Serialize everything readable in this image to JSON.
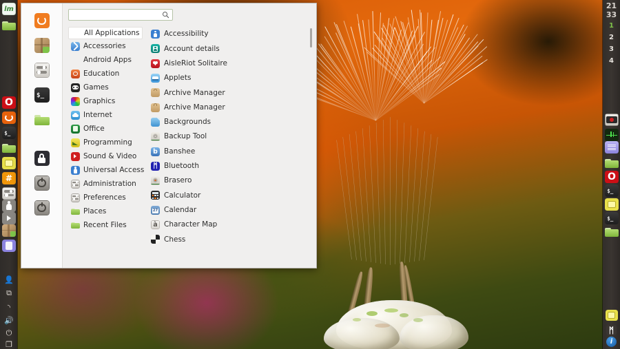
{
  "desktop": {
    "wallpaper_description": "dandelion seed head macro on orange and green bokeh background",
    "wallpaper_colors": {
      "orange": "#e4690c",
      "green": "#3e4a12",
      "magenta": "#8c1a6e"
    }
  },
  "left_panel": {
    "background": "#35312d",
    "launcher_items": [
      {
        "name": "linux-mint-menu-icon",
        "label": "Menu",
        "color": "#e8f3e8",
        "glyph": "lm"
      },
      {
        "name": "file-manager-icon",
        "label": "Files",
        "color": "#8bc34a",
        "glyph": "folder"
      },
      {
        "name": "opera-icon",
        "label": "Opera",
        "color": "#cc0f16",
        "glyph": "O"
      },
      {
        "name": "ubuntu-icon",
        "label": "Ubuntu",
        "color": "#e8620c",
        "glyph": "U"
      },
      {
        "name": "terminal-icon",
        "label": "Terminal",
        "color": "#2a2a2a",
        "glyph": "$_"
      },
      {
        "name": "folder-icon",
        "label": "Folder",
        "color": "#8bc34a",
        "glyph": "folder"
      },
      {
        "name": "notes-icon",
        "label": "Notes",
        "color": "#e8e04a",
        "glyph": "note"
      },
      {
        "name": "hash-icon",
        "label": "Hash",
        "color": "#f0960a",
        "glyph": "#"
      },
      {
        "name": "settings-toggle-icon",
        "label": "Settings",
        "color": "#d5d2cd",
        "glyph": "toggle"
      },
      {
        "name": "user-avatar-icon",
        "label": "User",
        "color": "#8a8782",
        "glyph": "person"
      },
      {
        "name": "media-player-icon",
        "label": "Player",
        "color": "#8a8782",
        "glyph": "play"
      },
      {
        "name": "package-icon",
        "label": "Package",
        "color": "#b08a5a",
        "glyph": "box"
      },
      {
        "name": "reader-icon",
        "label": "Reader",
        "color": "#8c84e0",
        "glyph": "book"
      }
    ],
    "tray_items": [
      {
        "name": "user-account-tray-icon",
        "label": "User account"
      },
      {
        "name": "screenshot-tray-icon",
        "label": "Screenshot"
      },
      {
        "name": "network-wifi-tray-icon",
        "label": "Network"
      },
      {
        "name": "volume-tray-icon",
        "label": "Volume"
      },
      {
        "name": "logout-tray-icon",
        "label": "Log out"
      },
      {
        "name": "displays-tray-icon",
        "label": "Displays"
      }
    ]
  },
  "right_panel": {
    "background": "#3a3531",
    "clock": {
      "hours": "21",
      "minutes": "33"
    },
    "workspaces": [
      {
        "label": "1",
        "active": true
      },
      {
        "label": "2",
        "active": false
      },
      {
        "label": "3",
        "active": false
      },
      {
        "label": "4",
        "active": false
      }
    ],
    "items": [
      {
        "name": "camera-icon",
        "label": "Camera",
        "color": "#d9d4ce",
        "glyph": "camera"
      },
      {
        "name": "system-monitor-icon",
        "label": "System Monitor",
        "color": "#1d3a1d",
        "glyph": "pulse"
      },
      {
        "name": "text-editor-icon",
        "label": "Text Editor",
        "color": "#a9a2ea",
        "glyph": "lines"
      },
      {
        "name": "folder-icon",
        "label": "Folder",
        "color": "#8bc34a",
        "glyph": "folder"
      },
      {
        "name": "opera-icon",
        "label": "Opera",
        "color": "#cc0f16",
        "glyph": "O"
      },
      {
        "name": "terminal-icon",
        "label": "Terminal",
        "color": "#2a2a2a",
        "glyph": "$_"
      },
      {
        "name": "notes-icon",
        "label": "Notes",
        "color": "#e8e04a",
        "glyph": "note"
      },
      {
        "name": "terminal-icon",
        "label": "Terminal",
        "color": "#2a2a2a",
        "glyph": "$_"
      },
      {
        "name": "folder-icon",
        "label": "Folder",
        "color": "#8bc34a",
        "glyph": "folder"
      }
    ],
    "tray_items": [
      {
        "name": "notes-tray-icon",
        "label": "Notes",
        "color": "#e8e04a",
        "glyph": "note"
      },
      {
        "name": "bluetooth-tray-icon",
        "label": "Bluetooth",
        "color": "#3a3531",
        "glyph": "bt"
      },
      {
        "name": "update-manager-tray-icon",
        "label": "Update Manager",
        "color": "#1f6fc4",
        "glyph": "shield"
      }
    ]
  },
  "menu": {
    "search": {
      "value": "",
      "placeholder": ""
    },
    "search_icon": "search-icon",
    "favorites": [
      {
        "name": "software-updater-favorite-icon",
        "label": "Software Updater",
        "color": "#f07c20",
        "glyph": "U"
      },
      {
        "name": "software-manager-favorite-icon",
        "label": "Software Manager",
        "color": "#b08a5a",
        "glyph": "box"
      },
      {
        "name": "system-settings-favorite-icon",
        "label": "System Settings",
        "color": "#e4e2de",
        "glyph": "toggle"
      },
      {
        "name": "terminal-favorite-icon",
        "label": "Terminal",
        "color": "#232323",
        "glyph": "$_"
      },
      {
        "name": "files-favorite-icon",
        "label": "Files",
        "color": "#8bc34a",
        "glyph": "folder"
      },
      {
        "name": "lock-screen-favorite-icon",
        "label": "Lock Screen",
        "color": "#2d2d33",
        "glyph": "lock"
      },
      {
        "name": "logout-favorite-icon",
        "label": "Log Out",
        "color": "#8e8b87",
        "glyph": "power"
      },
      {
        "name": "quit-favorite-icon",
        "label": "Quit",
        "color": "#8e8b87",
        "glyph": "power"
      }
    ],
    "categories": [
      {
        "label": "All Applications",
        "icon": "",
        "selected": true
      },
      {
        "label": "Accessories",
        "icon": "accessories-icon",
        "color": "#4a90d9",
        "glyph": "tools",
        "selected": false
      },
      {
        "label": "Android Apps",
        "icon": "",
        "selected": false
      },
      {
        "label": "Education",
        "icon": "education-icon",
        "color": "#d94f20",
        "glyph": "circle",
        "selected": false
      },
      {
        "label": "Games",
        "icon": "games-icon",
        "color": "#2b2b2b",
        "glyph": "pad",
        "selected": false
      },
      {
        "label": "Graphics",
        "icon": "graphics-icon",
        "color": "#9b4fd0",
        "glyph": "wheel",
        "selected": false
      },
      {
        "label": "Internet",
        "icon": "internet-icon",
        "color": "#3a9fe0",
        "glyph": "cloud",
        "selected": false
      },
      {
        "label": "Office",
        "icon": "office-icon",
        "color": "#1f7a34",
        "glyph": "doc",
        "selected": false
      },
      {
        "label": "Programming",
        "icon": "programming-icon",
        "color": "#e4d020",
        "glyph": "chart",
        "selected": false
      },
      {
        "label": "Sound & Video",
        "icon": "sound-video-icon",
        "color": "#d01f1f",
        "glyph": "play",
        "selected": false
      },
      {
        "label": "Universal Access",
        "icon": "universal-access-icon",
        "color": "#3a7fd0",
        "glyph": "person",
        "selected": false
      },
      {
        "label": "Administration",
        "icon": "administration-icon",
        "color": "#d7d4cf",
        "glyph": "toggle",
        "selected": false
      },
      {
        "label": "Preferences",
        "icon": "preferences-icon",
        "color": "#d7d4cf",
        "glyph": "toggle",
        "selected": false
      },
      {
        "label": "Places",
        "icon": "places-icon",
        "color": "#8bc34a",
        "glyph": "folder",
        "selected": false
      },
      {
        "label": "Recent Files",
        "icon": "recent-files-icon",
        "color": "#8bc34a",
        "glyph": "folder",
        "selected": false
      }
    ],
    "applications": [
      {
        "label": "Accessibility",
        "icon": "accessibility-icon",
        "color": "#3a7fd0",
        "glyph": "person"
      },
      {
        "label": "Account details",
        "icon": "account-details-icon",
        "color": "#149a8e",
        "glyph": "id"
      },
      {
        "label": "AisleRiot Solitaire",
        "icon": "aisleriot-solitaire-icon",
        "color": "#d01f2a",
        "glyph": "heart"
      },
      {
        "label": "Applets",
        "icon": "applets-icon",
        "color": "#4aa3e8",
        "glyph": "window"
      },
      {
        "label": "Archive Manager",
        "icon": "archive-manager-icon",
        "color": "#dcb887",
        "glyph": "bag"
      },
      {
        "label": "Archive Manager",
        "icon": "archive-manager-icon",
        "color": "#dcb887",
        "glyph": "bag"
      },
      {
        "label": "Backgrounds",
        "icon": "backgrounds-icon",
        "color": "#5aa8e0",
        "glyph": "page"
      },
      {
        "label": "Backup Tool",
        "icon": "backup-tool-icon",
        "color": "#dedbd6",
        "glyph": "disc"
      },
      {
        "label": "Banshee",
        "icon": "banshee-icon",
        "color": "#4a8fd0",
        "glyph": "b"
      },
      {
        "label": "Bluetooth",
        "icon": "bluetooth-icon",
        "color": "#2020b0",
        "glyph": "bt"
      },
      {
        "label": "Brasero",
        "icon": "brasero-icon",
        "color": "#e8620c",
        "glyph": "disc"
      },
      {
        "label": "Calculator",
        "icon": "calculator-icon",
        "color": "#2b2b2b",
        "glyph": "calc"
      },
      {
        "label": "Calendar",
        "icon": "calendar-icon",
        "color": "#5a8fc8",
        "glyph": "cal"
      },
      {
        "label": "Character Map",
        "icon": "character-map-icon",
        "color": "#e4e2de",
        "glyph": "char"
      },
      {
        "label": "Chess",
        "icon": "chess-icon",
        "color": "#2b2b2b",
        "glyph": "chess"
      }
    ],
    "scrollbar": {
      "name": "app-list-scrollbar"
    }
  }
}
